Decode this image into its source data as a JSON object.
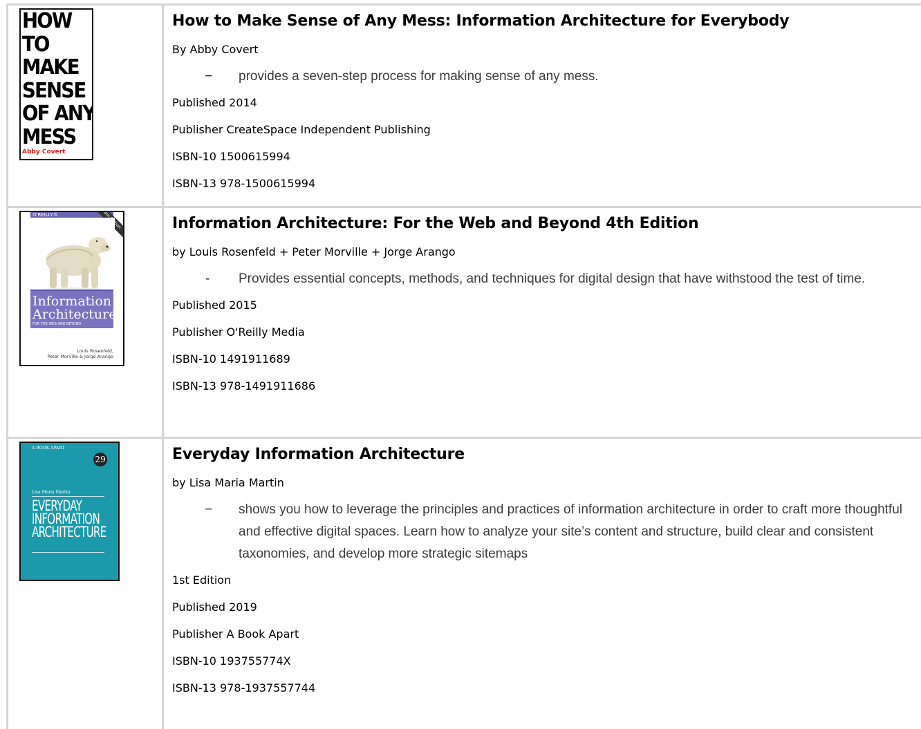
{
  "books": [
    {
      "title": "How to Make Sense of Any Mess: Information Architecture for Everybody",
      "author": "By Abby Covert",
      "desc_dash": "−",
      "description": "provides a seven-step process for making sense of any mess.",
      "details": [
        "Published 2014",
        "Publisher CreateSpace Independent Publishing",
        "ISBN-10 1500615994",
        "ISBN-13 978-1500615994"
      ],
      "cover": {
        "lines": [
          "HOW",
          "TO",
          "MAKE",
          "SENSE",
          "OF ANY",
          "MESS"
        ],
        "author": "Abby Covert"
      }
    },
    {
      "title": "Information Architecture: For the Web and Beyond 4th Edition",
      "author": "by Louis Rosenfeld + Peter Morville + Jorge Arango",
      "desc_dash": "-",
      "description": "Provides essential concepts, methods, and techniques for digital design that have withstood the test of time.",
      "details": [
        "Published 2015",
        "Publisher O'Reilly Media",
        "ISBN-10 1491911689",
        "ISBN-13 978-1491911686"
      ],
      "cover": {
        "publisher": "O'REILLY®",
        "edition": "4th Edition",
        "title_line1": "Information",
        "title_line2": "Architecture",
        "subtitle": "FOR THE WEB AND BEYOND",
        "authors_line1": "Louis Rosenfeld,",
        "authors_line2": "Peter Morville & Jorge Arango"
      }
    },
    {
      "title": "Everyday Information Architecture",
      "author": "by Lisa Maria Martin",
      "desc_dash": "−",
      "description": "shows you how to leverage the principles and practices of information architecture in order to craft more thoughtful and effective digital spaces. Learn how to analyze your site’s content and structure, build clear and consistent taxonomies, and develop more strategic sitemaps",
      "details": [
        "1st Edition",
        "Published 2019",
        "Publisher A Book Apart",
        "ISBN-10 193755774X",
        "ISBN-13 978-1937557744"
      ],
      "cover": {
        "series": "A BOOK APART",
        "number": "29",
        "author": "Lisa Maria Martin",
        "lines": [
          "EVERYDAY",
          "INFORMATION",
          "ARCHITECTURE"
        ]
      }
    }
  ],
  "colors": {
    "border": "#d6d6d6",
    "oreilly_purple": "#7b73c1",
    "bookapart_teal": "#1c9aab",
    "cover_red": "#e31b1b"
  }
}
